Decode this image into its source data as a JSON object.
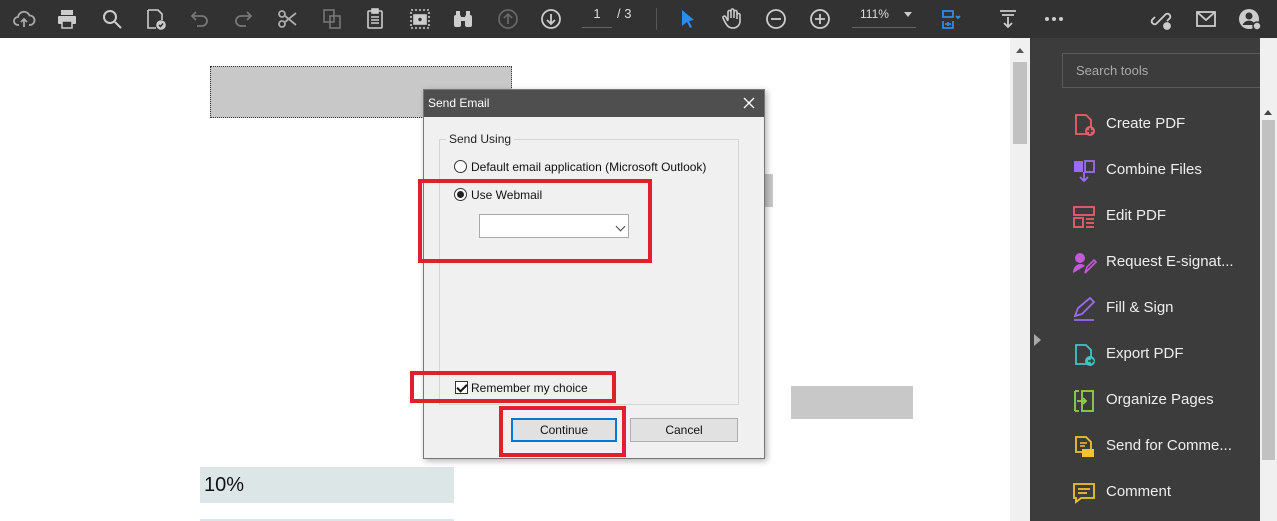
{
  "toolbar": {
    "page_current": "1",
    "page_total": "/ 3",
    "zoom": "111%",
    "icons": [
      "upload-icon",
      "print-icon",
      "zoom-search-icon",
      "edit-check-icon",
      "undo-icon",
      "redo-icon",
      "cut-icon",
      "copy-icon",
      "clipboard-icon",
      "screenshot-icon",
      "binoculars-icon",
      "prev-page-icon",
      "next-page-icon",
      "select-cursor-icon",
      "hand-icon",
      "zoom-out-icon",
      "zoom-in-icon",
      "fit-page-icon",
      "scroll-mode-icon",
      "more-icon",
      "share-link-icon",
      "email-icon",
      "account-icon"
    ]
  },
  "document": {
    "percent_cell": "10%"
  },
  "tools_pane": {
    "search_placeholder": "Search tools",
    "items": [
      {
        "label": "Create PDF",
        "icon": "create-pdf-icon",
        "color": "#e8606a"
      },
      {
        "label": "Combine Files",
        "icon": "combine-files-icon",
        "color": "#9b6cf0"
      },
      {
        "label": "Edit PDF",
        "icon": "edit-pdf-icon",
        "color": "#e8606a"
      },
      {
        "label": "Request E-signat...",
        "icon": "request-esign-icon",
        "color": "#c35bd6"
      },
      {
        "label": "Fill & Sign",
        "icon": "fill-sign-icon",
        "color": "#9b6cf0"
      },
      {
        "label": "Export PDF",
        "icon": "export-pdf-icon",
        "color": "#3bc6c6"
      },
      {
        "label": "Organize Pages",
        "icon": "organize-pages-icon",
        "color": "#8fd14f"
      },
      {
        "label": "Send for Comme...",
        "icon": "send-comments-icon",
        "color": "#f1c232"
      },
      {
        "label": "Comment",
        "icon": "comment-icon",
        "color": "#f1c232"
      }
    ]
  },
  "dialog": {
    "title": "Send Email",
    "group_label": "Send Using",
    "option_default": "Default email application (Microsoft Outlook)",
    "option_webmail": "Use Webmail",
    "webmail_select_value": "",
    "remember_label": "Remember my choice",
    "remember_checked": true,
    "continue_label": "Continue",
    "cancel_label": "Cancel"
  },
  "colors": {
    "highlight": "#e0202c",
    "toolbar_bg": "#323232",
    "pane_bg": "#3c3c3c",
    "active_blue": "#2d8ceb"
  }
}
